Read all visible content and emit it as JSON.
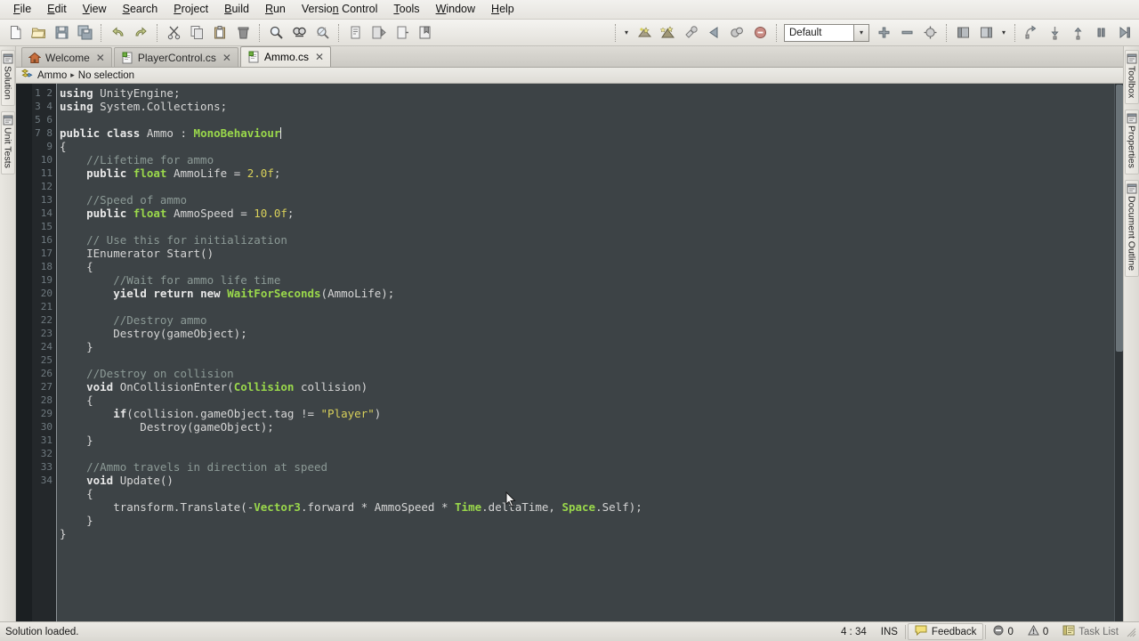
{
  "menu": {
    "items": [
      {
        "pre": "",
        "acc": "F",
        "post": "ile"
      },
      {
        "pre": "",
        "acc": "E",
        "post": "dit"
      },
      {
        "pre": "",
        "acc": "V",
        "post": "iew"
      },
      {
        "pre": "",
        "acc": "S",
        "post": "earch"
      },
      {
        "pre": "",
        "acc": "P",
        "post": "roject"
      },
      {
        "pre": "",
        "acc": "B",
        "post": "uild"
      },
      {
        "pre": "",
        "acc": "R",
        "post": "un"
      },
      {
        "pre": "Versio",
        "acc": "n",
        "post": " Control"
      },
      {
        "pre": "",
        "acc": "T",
        "post": "ools"
      },
      {
        "pre": "",
        "acc": "W",
        "post": "indow"
      },
      {
        "pre": "",
        "acc": "H",
        "post": "elp"
      }
    ]
  },
  "toolbar": {
    "groups": [
      [
        "new-file-icon",
        "open-folder-icon",
        "save-icon",
        "save-all-icon"
      ],
      [
        "undo-icon",
        "redo-icon"
      ],
      [
        "cut-icon",
        "copy-icon",
        "paste-icon",
        "delete-icon"
      ],
      [
        "find-icon",
        "find-replace-icon",
        "find-next-icon"
      ],
      [
        "comment-icon",
        "uncomment-icon",
        "indent-icon",
        "bookmark-icon"
      ]
    ],
    "right_groups": [
      [
        "build-icon",
        "rebuild-icon",
        "debug-attach-icon",
        "run-icon",
        "stop-build-icon",
        "stop-icon"
      ],
      [
        "zoom-in-icon",
        "zoom-out-icon",
        "zoom-reset-icon"
      ],
      [
        "layout-icon",
        "layout-alt-icon"
      ],
      [
        "step-over-icon",
        "step-into-icon",
        "step-out-icon",
        "pause-icon",
        "continue-icon"
      ]
    ],
    "configuration_value": "Default",
    "configuration_placeholder": "Default",
    "dropdown_arrow": "▼",
    "split_arrow": "▾"
  },
  "left_rail": {
    "items": [
      {
        "label": "Solution",
        "icon": "solution-pad-icon"
      },
      {
        "label": "Unit Tests",
        "icon": "unit-tests-pad-icon"
      }
    ]
  },
  "right_rail": {
    "items": [
      {
        "label": "Toolbox",
        "icon": "toolbox-pad-icon"
      },
      {
        "label": "Properties",
        "icon": "properties-pad-icon"
      },
      {
        "label": "Document Outline",
        "icon": "document-outline-pad-icon"
      }
    ]
  },
  "tabs": {
    "close_glyph": "✕",
    "items": [
      {
        "label": "Welcome",
        "icon": "home-icon",
        "active": false
      },
      {
        "label": "PlayerControl.cs",
        "icon": "csharp-file-icon",
        "active": false
      },
      {
        "label": "Ammo.cs",
        "icon": "csharp-file-icon",
        "active": true
      }
    ]
  },
  "breadcrumb": {
    "icon": "class-icon",
    "class_name": "Ammo",
    "separator": "▸",
    "member_name": "No selection"
  },
  "editor": {
    "first_line": 1,
    "total_lines": 34,
    "line_numbers": [
      1,
      2,
      3,
      4,
      5,
      6,
      7,
      8,
      9,
      10,
      11,
      12,
      13,
      14,
      15,
      16,
      17,
      18,
      19,
      20,
      21,
      22,
      23,
      24,
      25,
      26,
      27,
      28,
      29,
      30,
      31,
      32,
      33,
      34
    ],
    "lines": [
      {
        "n": 1,
        "tokens": [
          {
            "t": "using",
            "c": "k"
          },
          {
            "t": " UnityEngine;",
            "c": "pl"
          }
        ]
      },
      {
        "n": 2,
        "tokens": [
          {
            "t": "using",
            "c": "k"
          },
          {
            "t": " System.Collections;",
            "c": "pl"
          }
        ]
      },
      {
        "n": 3,
        "tokens": []
      },
      {
        "n": 4,
        "tokens": [
          {
            "t": "public",
            "c": "k"
          },
          {
            "t": " ",
            "c": "pl"
          },
          {
            "t": "class",
            "c": "k"
          },
          {
            "t": " Ammo : ",
            "c": "pl"
          },
          {
            "t": "MonoBehaviour",
            "c": "ty"
          },
          {
            "t": "|CARET|",
            "c": "caret"
          }
        ]
      },
      {
        "n": 5,
        "tokens": [
          {
            "t": "{",
            "c": "pl"
          }
        ]
      },
      {
        "n": 6,
        "tokens": [
          {
            "t": "    //Lifetime for ammo",
            "c": "cm"
          }
        ]
      },
      {
        "n": 7,
        "tokens": [
          {
            "t": "    ",
            "c": "pl"
          },
          {
            "t": "public",
            "c": "k"
          },
          {
            "t": " ",
            "c": "pl"
          },
          {
            "t": "float",
            "c": "ty"
          },
          {
            "t": " AmmoLife = ",
            "c": "pl"
          },
          {
            "t": "2.0f",
            "c": "nu"
          },
          {
            "t": ";",
            "c": "pl"
          }
        ]
      },
      {
        "n": 8,
        "tokens": []
      },
      {
        "n": 9,
        "tokens": [
          {
            "t": "    //Speed of ammo",
            "c": "cm"
          }
        ]
      },
      {
        "n": 10,
        "tokens": [
          {
            "t": "    ",
            "c": "pl"
          },
          {
            "t": "public",
            "c": "k"
          },
          {
            "t": " ",
            "c": "pl"
          },
          {
            "t": "float",
            "c": "ty"
          },
          {
            "t": " AmmoSpeed = ",
            "c": "pl"
          },
          {
            "t": "10.0f",
            "c": "nu"
          },
          {
            "t": ";",
            "c": "pl"
          }
        ]
      },
      {
        "n": 11,
        "tokens": []
      },
      {
        "n": 12,
        "tokens": [
          {
            "t": "    // Use this for initialization",
            "c": "cm"
          }
        ]
      },
      {
        "n": 13,
        "tokens": [
          {
            "t": "    IEnumerator Start()",
            "c": "pl"
          }
        ]
      },
      {
        "n": 14,
        "tokens": [
          {
            "t": "    {",
            "c": "pl"
          }
        ]
      },
      {
        "n": 15,
        "tokens": [
          {
            "t": "        //Wait for ammo life time",
            "c": "cm"
          }
        ]
      },
      {
        "n": 16,
        "tokens": [
          {
            "t": "        ",
            "c": "pl"
          },
          {
            "t": "yield",
            "c": "k"
          },
          {
            "t": " ",
            "c": "pl"
          },
          {
            "t": "return",
            "c": "k"
          },
          {
            "t": " ",
            "c": "pl"
          },
          {
            "t": "new",
            "c": "k"
          },
          {
            "t": " ",
            "c": "pl"
          },
          {
            "t": "WaitForSeconds",
            "c": "ty"
          },
          {
            "t": "(AmmoLife);",
            "c": "pl"
          }
        ]
      },
      {
        "n": 17,
        "tokens": []
      },
      {
        "n": 18,
        "tokens": [
          {
            "t": "        //Destroy ammo",
            "c": "cm"
          }
        ]
      },
      {
        "n": 19,
        "tokens": [
          {
            "t": "        Destroy(gameObject);",
            "c": "pl"
          }
        ]
      },
      {
        "n": 20,
        "tokens": [
          {
            "t": "    }",
            "c": "pl"
          }
        ]
      },
      {
        "n": 21,
        "tokens": []
      },
      {
        "n": 22,
        "tokens": [
          {
            "t": "    //Destroy on collision",
            "c": "cm"
          }
        ]
      },
      {
        "n": 23,
        "tokens": [
          {
            "t": "    ",
            "c": "pl"
          },
          {
            "t": "void",
            "c": "k"
          },
          {
            "t": " OnCollisionEnter(",
            "c": "pl"
          },
          {
            "t": "Collision",
            "c": "ty"
          },
          {
            "t": " collision)",
            "c": "pl"
          }
        ]
      },
      {
        "n": 24,
        "tokens": [
          {
            "t": "    {",
            "c": "pl"
          }
        ]
      },
      {
        "n": 25,
        "tokens": [
          {
            "t": "        ",
            "c": "pl"
          },
          {
            "t": "if",
            "c": "k"
          },
          {
            "t": "(collision.gameObject.tag != ",
            "c": "pl"
          },
          {
            "t": "\"Player\"",
            "c": "st"
          },
          {
            "t": ")",
            "c": "pl"
          }
        ]
      },
      {
        "n": 26,
        "tokens": [
          {
            "t": "            Destroy(gameObject);",
            "c": "pl"
          }
        ]
      },
      {
        "n": 27,
        "tokens": [
          {
            "t": "    }",
            "c": "pl"
          }
        ]
      },
      {
        "n": 28,
        "tokens": []
      },
      {
        "n": 29,
        "tokens": [
          {
            "t": "    //Ammo travels in direction at speed",
            "c": "cm"
          }
        ]
      },
      {
        "n": 30,
        "tokens": [
          {
            "t": "    ",
            "c": "pl"
          },
          {
            "t": "void",
            "c": "k"
          },
          {
            "t": " Update()",
            "c": "pl"
          }
        ]
      },
      {
        "n": 31,
        "tokens": [
          {
            "t": "    {",
            "c": "pl"
          }
        ]
      },
      {
        "n": 32,
        "tokens": [
          {
            "t": "        transform.Translate(-",
            "c": "pl"
          },
          {
            "t": "Vector3",
            "c": "ty"
          },
          {
            "t": ".forward * AmmoSpeed * ",
            "c": "pl"
          },
          {
            "t": "Time",
            "c": "ty"
          },
          {
            "t": ".deltaTime, ",
            "c": "pl"
          },
          {
            "t": "Space",
            "c": "ty"
          },
          {
            "t": ".Self);",
            "c": "pl"
          }
        ]
      },
      {
        "n": 33,
        "tokens": [
          {
            "t": "    }",
            "c": "pl"
          }
        ]
      },
      {
        "n": 34,
        "tokens": [
          {
            "t": "}",
            "c": "pl"
          }
        ]
      }
    ],
    "colors": {
      "background": "#3d4346",
      "gutter_background": "#24282b",
      "gutter_text": "#6f7a80",
      "plain": "#d6d6d6",
      "keyword": "#e8e8e8",
      "type": "#9ad84b",
      "comment": "#8c9a96",
      "string": "#d8d05a",
      "number": "#d8d05a"
    }
  },
  "statusbar": {
    "message": "Solution loaded.",
    "caret_position": "4 : 34",
    "insert_mode": "INS",
    "feedback_label": "Feedback",
    "feedback_icon": "speech-bubble-icon",
    "error_icon": "error-icon",
    "error_count": "0",
    "warning_icon": "warning-icon",
    "warning_count": "0",
    "task_list_icon": "task-list-icon",
    "task_list_label": "Task List"
  }
}
